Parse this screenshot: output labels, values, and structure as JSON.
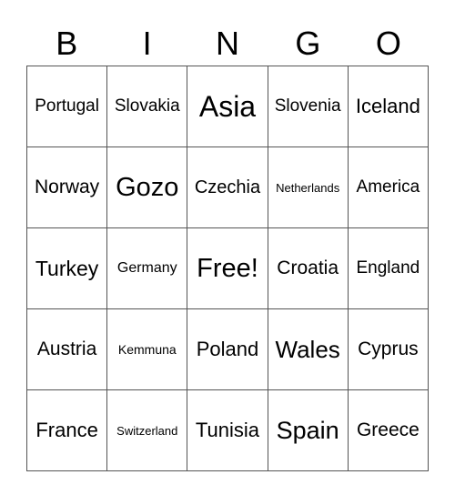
{
  "header": [
    "B",
    "I",
    "N",
    "G",
    "O"
  ],
  "rows": [
    [
      {
        "text": "Portugal",
        "size": 19
      },
      {
        "text": "Slovakia",
        "size": 19
      },
      {
        "text": "Asia",
        "size": 32
      },
      {
        "text": "Slovenia",
        "size": 19
      },
      {
        "text": "Iceland",
        "size": 22
      }
    ],
    [
      {
        "text": "Norway",
        "size": 21
      },
      {
        "text": "Gozo",
        "size": 29
      },
      {
        "text": "Czechia",
        "size": 20
      },
      {
        "text": "Netherlands",
        "size": 13
      },
      {
        "text": "America",
        "size": 19
      }
    ],
    [
      {
        "text": "Turkey",
        "size": 23
      },
      {
        "text": "Germany",
        "size": 16
      },
      {
        "text": "Free!",
        "size": 29
      },
      {
        "text": "Croatia",
        "size": 21
      },
      {
        "text": "England",
        "size": 19
      }
    ],
    [
      {
        "text": "Austria",
        "size": 21
      },
      {
        "text": "Kemmuna",
        "size": 14
      },
      {
        "text": "Poland",
        "size": 22
      },
      {
        "text": "Wales",
        "size": 26
      },
      {
        "text": "Cyprus",
        "size": 21
      }
    ],
    [
      {
        "text": "France",
        "size": 22
      },
      {
        "text": "Switzerland",
        "size": 13
      },
      {
        "text": "Tunisia",
        "size": 22
      },
      {
        "text": "Spain",
        "size": 27
      },
      {
        "text": "Greece",
        "size": 21
      }
    ]
  ]
}
